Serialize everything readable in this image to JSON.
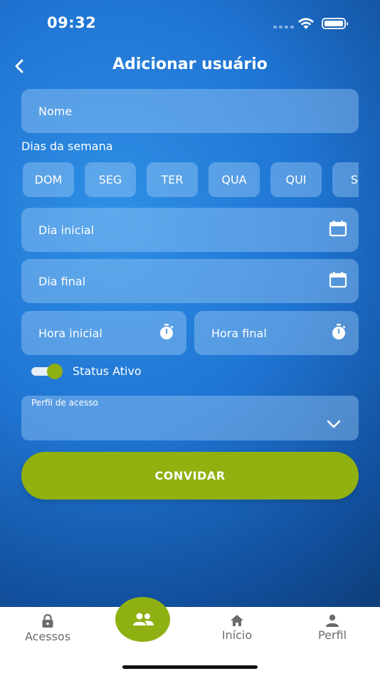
{
  "status_bar": {
    "time": "09:32"
  },
  "header": {
    "title": "Adicionar usuário"
  },
  "form": {
    "name_placeholder": "Nome",
    "weekdays_label": "Dias da semana",
    "weekdays": [
      "DOM",
      "SEG",
      "TER",
      "QUA",
      "QUI",
      "SE"
    ],
    "start_date_placeholder": "Dia inicial",
    "end_date_placeholder": "Dia final",
    "start_time_placeholder": "Hora inicial",
    "end_time_placeholder": "Hora final",
    "status_label": "Status Ativo",
    "status_active": true,
    "access_profile_label": "Perfil de acesso",
    "access_profile_value": "",
    "invite_label": "CONVIDAR"
  },
  "tabbar": {
    "items": [
      {
        "label": "Acessos",
        "icon": "lock-icon"
      },
      {
        "label": "",
        "icon": "users-icon",
        "active": true
      },
      {
        "label": "Início",
        "icon": "home-icon"
      },
      {
        "label": "Perfil",
        "icon": "person-icon"
      }
    ]
  },
  "colors": {
    "accent_green": "#8fb012",
    "background_blue": "#1f74d2",
    "field_fill": "#a0cdf5"
  }
}
